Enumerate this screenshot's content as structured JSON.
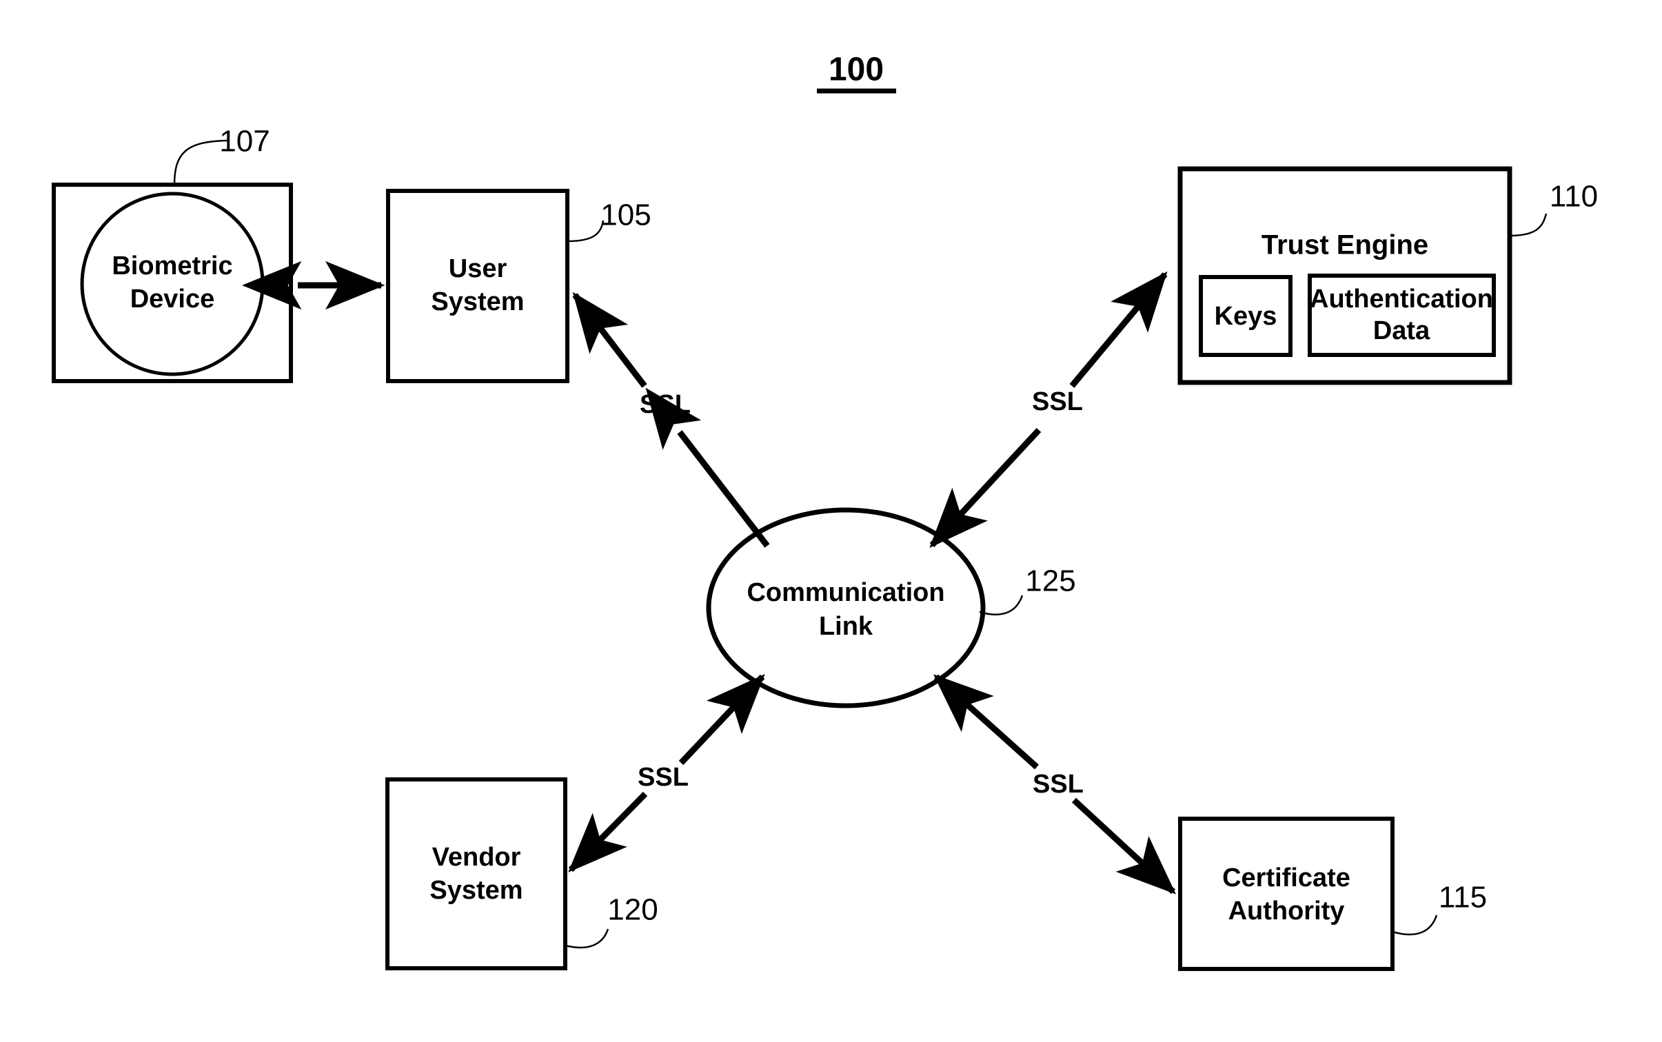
{
  "figure": {
    "title": "100",
    "title_underlined": true,
    "background_color": "#ffffff",
    "line_color": "#000000"
  },
  "nodes": {
    "biometric_device": {
      "label_line1": "Biometric",
      "label_line2": "Device",
      "ref": "107",
      "shape": "rect-with-circle"
    },
    "user_system": {
      "label_line1": "User",
      "label_line2": "System",
      "ref": "105",
      "shape": "rect"
    },
    "trust_engine": {
      "label": "Trust Engine",
      "ref": "110",
      "shape": "rect",
      "children": {
        "keys": {
          "label": "Keys",
          "shape": "rect"
        },
        "authentication_data": {
          "label_line1": "Authentication",
          "label_line2": "Data",
          "shape": "rect"
        }
      }
    },
    "communication_link": {
      "label_line1": "Communication",
      "label_line2": "Link",
      "ref": "125",
      "shape": "ellipse"
    },
    "vendor_system": {
      "label_line1": "Vendor",
      "label_line2": "System",
      "ref": "120",
      "shape": "rect"
    },
    "certificate_authority": {
      "label_line1": "Certificate",
      "label_line2": "Authority",
      "ref": "115",
      "shape": "rect"
    }
  },
  "edges": [
    {
      "id": "biometric-to-user",
      "from": "biometric_device",
      "to": "user_system",
      "label": "",
      "arrows": "both"
    },
    {
      "id": "user-to-link",
      "from": "user_system",
      "to": "communication_link",
      "label": "SSL",
      "arrows": "both"
    },
    {
      "id": "link-to-trust-engine",
      "from": "communication_link",
      "to": "trust_engine",
      "label": "SSL",
      "arrows": "both"
    },
    {
      "id": "vendor-to-link",
      "from": "vendor_system",
      "to": "communication_link",
      "label": "SSL",
      "arrows": "both"
    },
    {
      "id": "link-to-certificate-authority",
      "from": "communication_link",
      "to": "certificate_authority",
      "label": "SSL",
      "arrows": "both"
    }
  ]
}
